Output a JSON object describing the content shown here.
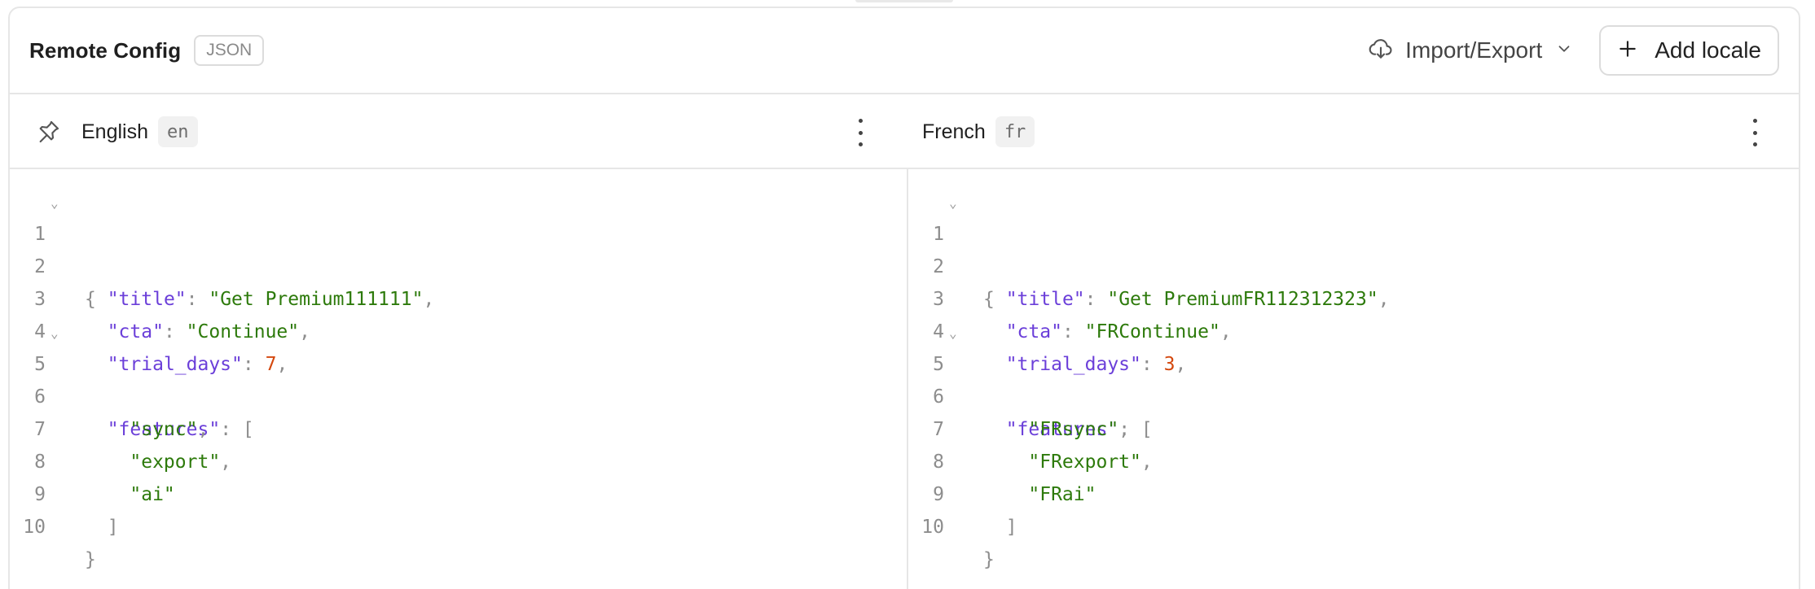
{
  "header": {
    "title": "Remote Config",
    "badge": "JSON",
    "import_export_label": "Import/Export",
    "add_locale_label": "Add locale"
  },
  "locales": [
    {
      "name": "English",
      "code": "en",
      "pinned": true
    },
    {
      "name": "French",
      "code": "fr",
      "pinned": false
    }
  ],
  "editors": {
    "en": {
      "line_numbers": [
        "1",
        "2",
        "3",
        "4",
        "5",
        "6",
        "7",
        "8",
        "9",
        "10"
      ],
      "title_key": "\"title\"",
      "title_value": "\"Get Premium111111\"",
      "cta_key": "\"cta\"",
      "cta_value": "\"Continue\"",
      "trial_key": "\"trial_days\"",
      "trial_value": "7",
      "features_key": "\"features\"",
      "features": [
        "\"sync\"",
        "\"export\"",
        "\"ai\""
      ]
    },
    "fr": {
      "line_numbers": [
        "1",
        "2",
        "3",
        "4",
        "5",
        "6",
        "7",
        "8",
        "9",
        "10"
      ],
      "title_key": "\"title\"",
      "title_value": "\"Get PremiumFR112312323\"",
      "cta_key": "\"cta\"",
      "cta_value": "\"FRContinue\"",
      "trial_key": "\"trial_days\"",
      "trial_value": "3",
      "features_key": "\"features\"",
      "features": [
        "\"FRsync\"",
        "\"FRexport\"",
        "\"FRai\""
      ]
    }
  },
  "icons": {
    "import_export": "cloud-download-icon",
    "chevron": "chevron-down-icon",
    "add": "plus-icon",
    "pin": "pin-icon",
    "more": "more-vertical-icon",
    "fold": "fold-chevron-icon"
  },
  "colors": {
    "json_key": "#6b3fd9",
    "json_string": "#2d7a0b",
    "json_number": "#d4480e",
    "punctuation": "#8d8d8d",
    "border": "#e6e6e6"
  }
}
